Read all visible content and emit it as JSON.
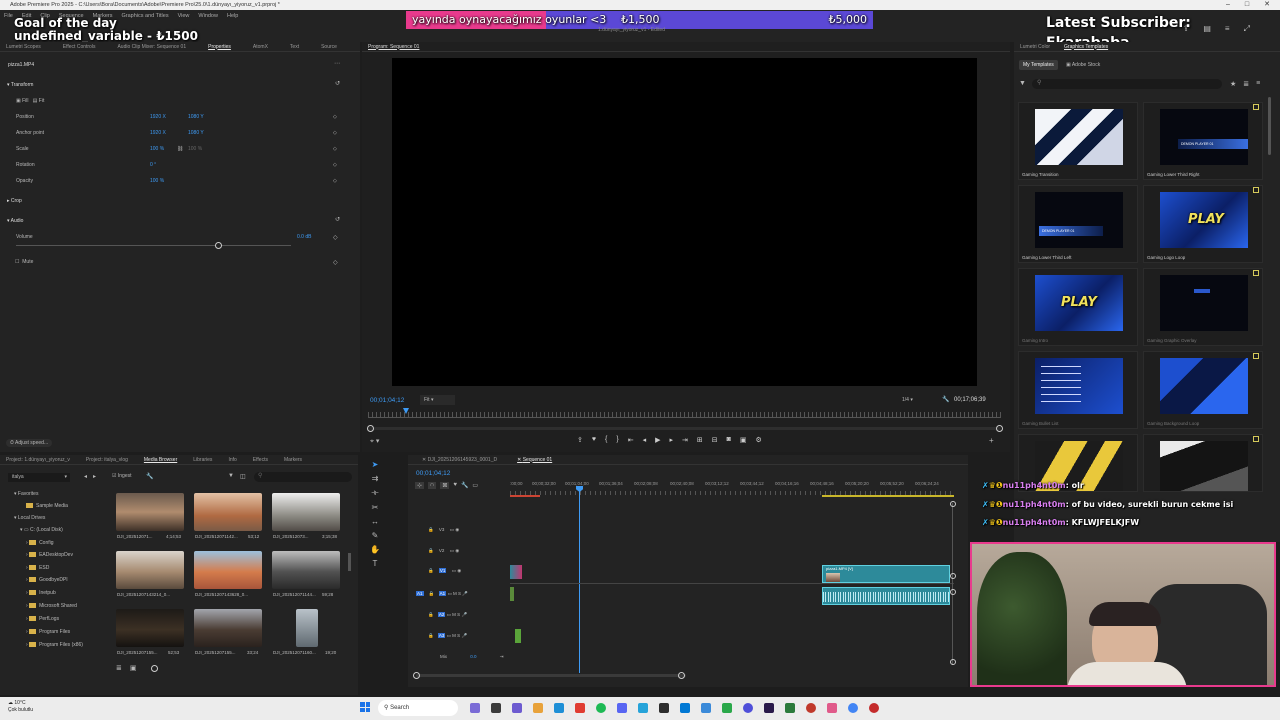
{
  "window": {
    "title": "Adobe Premiere Pro 2025 - C:\\Users\\Bora\\Documents\\Adobe\\Premiere Pro\\25.0\\1.dünyayı_yiyoruz_v1.prproj *"
  },
  "menu": [
    "File",
    "Edit",
    "Clip",
    "Sequence",
    "Markers",
    "Graphics and Titles",
    "View",
    "Window",
    "Help"
  ],
  "overlay": {
    "goal_label": "Goal of the day",
    "donation_line": "undefined_variable - ₺1500",
    "bar_text": "yayında oynayacağımız oyunlar <3",
    "bar_current": "₺1,500",
    "bar_target": "₺5,000",
    "bar_progress": 0.3,
    "latest_sub_label": "Latest Subscriber:",
    "latest_sub_name": "Fkarababa"
  },
  "left_tabs": [
    "Lumetri Scopes",
    "Effect Controls",
    "Audio Clip Mixer: Sequence 01",
    "Properties",
    "AtomX",
    "Text",
    "Source"
  ],
  "properties": {
    "clip": "pizza1.MP4",
    "transform": "Transform",
    "fill": "Fill",
    "fit": "Fit",
    "position": "Position",
    "pos_x": "1920 X",
    "pos_y": "1080 Y",
    "anchor": "Anchor point",
    "anc_x": "1920 X",
    "anc_y": "1080 Y",
    "scale": "Scale",
    "scale_v": "100 %",
    "scale_v2": "100 %",
    "rotation": "Rotation",
    "rot_v": "0 °",
    "opacity": "Opacity",
    "op_v": "100 %",
    "crop": "Crop",
    "audio": "Audio",
    "volume": "Volume",
    "vol_v": "0.0 dB",
    "mute": "Mute",
    "adjust_speed": "Adjust speed..."
  },
  "program": {
    "tab": "Program: Sequence 01",
    "title": "1.dünyayı_yiyoruz_v1 - Edited",
    "timecode": "00;01;04;12",
    "fit": "Fit",
    "ratio": "1/4",
    "duration": "00;17;06;39"
  },
  "graphics": {
    "tabs": [
      "Lumetri Color",
      "Graphics Templates"
    ],
    "my_templates": "My Templates",
    "adobe_stock": "Adobe Stock",
    "templates": [
      "Gaming Transition",
      "Gaming Lower Third Right",
      "Gaming Lower Third Left",
      "Gaming Logo Loop",
      "Gaming Intro",
      "Gaming Graphic Overlay",
      "Gaming Bullet List",
      "Gaming Background Loop",
      "",
      ""
    ],
    "play_text": "PLAY",
    "lower_third_text": "DEMON PLAYER 01"
  },
  "project": {
    "tabs": [
      "Project: 1.dünyayı_yiyoruz_v",
      "Project: italya_vlog",
      "Media Browser",
      "Libraries",
      "Info",
      "Effects",
      "Markers"
    ],
    "location": "italya",
    "ingest": "Ingest",
    "favorites": "Favorites",
    "sample_media": "Sample Media",
    "local_drives": "Local Drives",
    "c_drive": "C: (Local Disk)",
    "folders": [
      "Config",
      "EADesktopDev",
      "ESD",
      "GoodbyeDPI",
      "Inetpub",
      "Microsoft Shared",
      "PerfLogs",
      "Program Files",
      "Program Files (x86)"
    ],
    "clips": [
      {
        "name": "DJI_202512071...",
        "dur": "4;14;53"
      },
      {
        "name": "DJI_202512071142...",
        "dur": "53;12"
      },
      {
        "name": "DJI_202512073...",
        "dur": "3;15;38"
      },
      {
        "name": "DJI_20251207143214_0...",
        "dur": ""
      },
      {
        "name": "DJI_20251207143628_0...",
        "dur": ""
      },
      {
        "name": "DJI_202512071144...",
        "dur": "59;28"
      },
      {
        "name": "DJI_20251207155...",
        "dur": "52;53"
      },
      {
        "name": "DJI_20251207155...",
        "dur": "33;24"
      },
      {
        "name": "DJI_202512071160...",
        "dur": "19;20"
      }
    ]
  },
  "timeline": {
    "tab1": "DJI_20251206145923_0001_D",
    "tab2": "Sequence 01",
    "timecode": "00;01;04;12",
    "ruler": [
      ":00;00",
      "00;00;32;00",
      "00;01;04;00",
      "00;01;36;04",
      "00;02;08;08",
      "00;02;40;08",
      "00;03;12;12",
      "00;03;44;12",
      "00;04;16;16",
      "00;04;48;16",
      "00;05;20;20",
      "00;05;52;20",
      "00;06;24;24"
    ],
    "tracks": [
      "V3",
      "V2",
      "V1",
      "A1",
      "A2",
      "A3"
    ],
    "mix": "Mix",
    "mix_v": "0.0",
    "clip_video": "pizza1.MP4 [V]"
  },
  "chat": [
    {
      "user": "nu11ph4nt0m",
      "msg": "olr"
    },
    {
      "user": "nu11ph4nt0m",
      "msg": "of bu video, surekli burun cekme isi"
    },
    {
      "user": "nu11ph4nt0m",
      "msg": "KFLWJFELKJFW"
    }
  ],
  "taskbar": {
    "weather": "10°C",
    "weather_desc": "Çok bulutlu",
    "search": "Search"
  },
  "colors": {
    "accent": "#3e9bf5",
    "goal_bar": "#5b48d6",
    "goal_fill": "#e83a8d",
    "clip_teal": "#2d8a9a"
  }
}
